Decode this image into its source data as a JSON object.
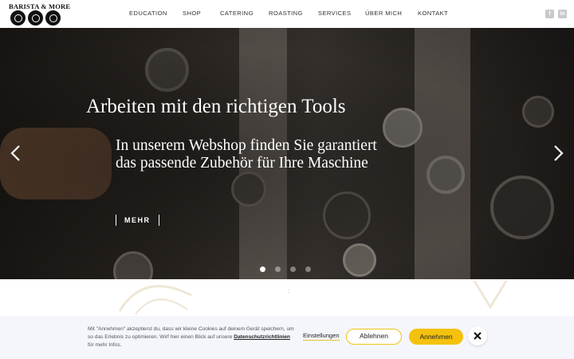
{
  "logo": {
    "text": "BARISTA & MORE"
  },
  "nav": {
    "items": [
      {
        "label": "EDUCATION"
      },
      {
        "label": "SHOP"
      },
      {
        "label": "CATERING"
      },
      {
        "label": "ROASTING"
      },
      {
        "label": "SERVICES"
      },
      {
        "label": "ÜBER MICH"
      },
      {
        "label": "KONTAKT"
      }
    ],
    "social": [
      {
        "icon": "facebook-icon",
        "glyph": "f"
      },
      {
        "icon": "linkedin-icon",
        "glyph": "in"
      }
    ]
  },
  "hero": {
    "title": "Arbeiten mit den richtigen Tools",
    "subtitle": "In unserem Webshop finden Sie garantiert das passende Zubehör für Ihre Maschine",
    "button_label": "MEHR",
    "slides_total": 4,
    "slide_active": 1,
    "prev_icon": "chevron-left-icon",
    "next_icon": "chevron-right-icon"
  },
  "cookie": {
    "text_before": "Mit \"Annehmen\" akzeptierst du, dass wir kleine Cookies auf deinem Gerät speichern, um so das Erlebnis zu optimieren. Wirf hier einen Blick auf unsere ",
    "policy_link": "Datenschutzrichtlinien",
    "text_after": " für mehr Infos.",
    "settings_label": "Einstellungen",
    "decline_label": "Ablehnen",
    "accept_label": "Annehmen",
    "close_icon": "close-icon"
  },
  "colors": {
    "accent": "#f4c20d",
    "cookie_bg": "#f4f6fb",
    "header_bg": "#ffffff"
  }
}
